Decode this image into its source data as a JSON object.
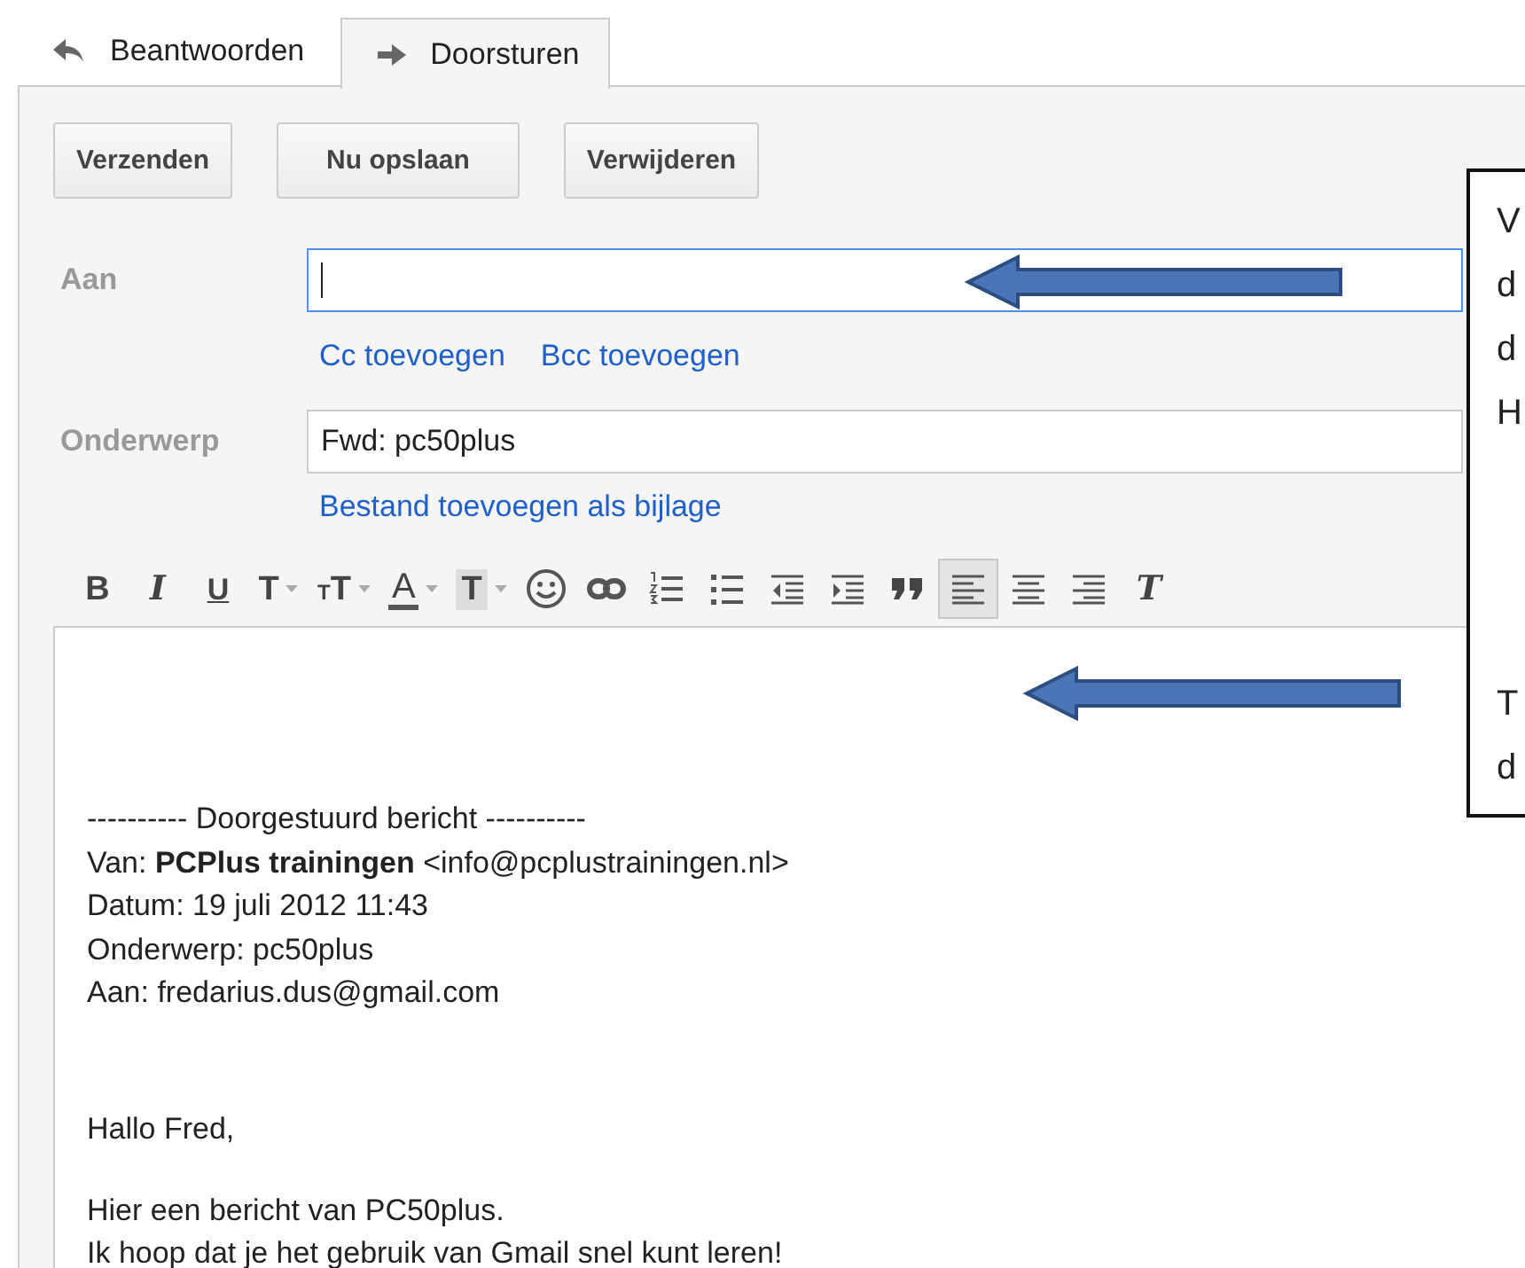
{
  "tabs": [
    {
      "label": "Beantwoorden",
      "kind": "reply",
      "selected": false
    },
    {
      "label": "Doorsturen",
      "kind": "forward",
      "selected": true
    }
  ],
  "buttons": [
    "Verzenden",
    "Nu opslaan",
    "Verwijderen"
  ],
  "to": {
    "label": "Aan",
    "focused": true
  },
  "recipient_links": [
    "Cc toevoegen",
    "Bcc toevoegen"
  ],
  "subject": {
    "label": "Onderwerp",
    "value": "Fwd: pc50plus"
  },
  "attach_link": "Bestand toevoegen als bijlage",
  "toolbar": [
    {
      "kind": "bold",
      "glyph": "B",
      "selected": false
    },
    {
      "kind": "italic",
      "glyph": "I",
      "selected": false
    },
    {
      "kind": "underline",
      "glyph": "U",
      "selected": false
    },
    {
      "kind": "font",
      "glyph": "T",
      "dropdown": true,
      "selected": false
    },
    {
      "kind": "size",
      "glyph_small": "T",
      "glyph": "T",
      "dropdown": true,
      "selected": false
    },
    {
      "kind": "color",
      "glyph": "A",
      "dropdown": true,
      "selected": false
    },
    {
      "kind": "highlight",
      "glyph": "T",
      "dropdown": true,
      "selected": false
    },
    {
      "kind": "emoji",
      "selected": false
    },
    {
      "kind": "link",
      "selected": false
    },
    {
      "kind": "numbered",
      "selected": false
    },
    {
      "kind": "bulleted",
      "selected": false
    },
    {
      "kind": "outdent",
      "selected": false
    },
    {
      "kind": "indent",
      "selected": false
    },
    {
      "kind": "quote",
      "selected": false
    },
    {
      "kind": "align-left",
      "selected": true
    },
    {
      "kind": "align-center",
      "selected": false
    },
    {
      "kind": "align-right",
      "selected": false
    },
    {
      "kind": "clear",
      "glyph": "T",
      "selected": false
    }
  ],
  "body": {
    "header_lines": [
      "---------- Doorgestuurd bericht ----------",
      "Van: **PCPlus trainingen** <info@pcplustrainingen.nl>",
      "Datum: 19 juli 2012 11:43",
      "Onderwerp: pc50plus",
      "Aan: fredarius.dus@gmail.com"
    ],
    "paragraphs": [
      [
        "Hallo Fred,"
      ],
      [
        "Hier een bericht van PC50plus.",
        "Ik hoop dat je het gebruik van Gmail snel kunt leren!"
      ]
    ]
  },
  "callout": {
    "paragraphs": [
      [
        "V",
        "d",
        "d",
        "H"
      ],
      [
        "T",
        "d"
      ]
    ]
  }
}
